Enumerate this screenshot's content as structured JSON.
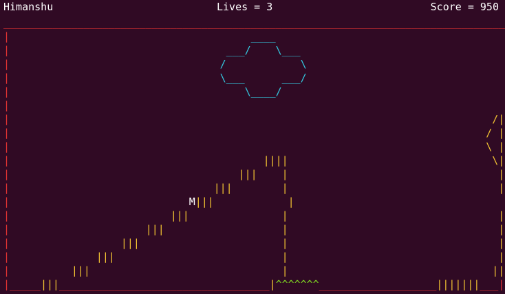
{
  "hud": {
    "player_name": "Himanshu",
    "lives": "Lives = 3",
    "score": "Score = 950"
  },
  "colors": {
    "background": "#300a24",
    "wall": "#e03333",
    "stair": "#f1c232",
    "cloud": "#33c7de",
    "spike": "#7ed321",
    "text": "#ffffff"
  },
  "board": {
    "rows": [
      [
        {
          "c": "wall",
          "t": "__________________________________________________________________________________________"
        }
      ],
      [
        {
          "c": "wall",
          "t": "|"
        },
        {
          "c": "cloud",
          "t": "                                       ____"
        },
        {
          "c": "wall",
          "t": "                                                   |"
        }
      ],
      [
        {
          "c": "wall",
          "t": "|"
        },
        {
          "c": "cloud",
          "t": "                                   ___/    \\___"
        },
        {
          "c": "wall",
          "t": "                                               |"
        }
      ],
      [
        {
          "c": "wall",
          "t": "|"
        },
        {
          "c": "cloud",
          "t": "                                  /            \\"
        },
        {
          "c": "wall",
          "t": "                                              |"
        }
      ],
      [
        {
          "c": "wall",
          "t": "|"
        },
        {
          "c": "cloud",
          "t": "                                  \\___      ___/"
        },
        {
          "c": "wall",
          "t": "                                              |"
        }
      ],
      [
        {
          "c": "wall",
          "t": "|"
        },
        {
          "c": "cloud",
          "t": "                                      \\____/"
        },
        {
          "c": "wall",
          "t": "                                                  |"
        }
      ],
      [
        {
          "c": "wall",
          "t": "|"
        },
        {
          "c": "wall",
          "t": "                                                                                          |"
        }
      ],
      [
        {
          "c": "wall",
          "t": "|"
        },
        {
          "c": "stair",
          "t": "                                                                              /|"
        },
        {
          "c": "wall",
          "t": "           |"
        }
      ],
      [
        {
          "c": "wall",
          "t": "|"
        },
        {
          "c": "stair",
          "t": "                                                                             / |"
        },
        {
          "c": "wall",
          "t": "           |"
        }
      ],
      [
        {
          "c": "wall",
          "t": "|"
        },
        {
          "c": "stair",
          "t": "                                                                             \\ |"
        },
        {
          "c": "wall",
          "t": "           |"
        }
      ],
      [
        {
          "c": "wall",
          "t": "|"
        },
        {
          "c": "stair",
          "t": "                                         ||||                                 \\|"
        },
        {
          "c": "wall",
          "t": "           |"
        }
      ],
      [
        {
          "c": "wall",
          "t": "|"
        },
        {
          "c": "stair",
          "t": "                                     |||    |                                  |"
        },
        {
          "c": "wall",
          "t": "           |"
        }
      ],
      [
        {
          "c": "wall",
          "t": "|"
        },
        {
          "c": "stair",
          "t": "                                 |||        |                                  |"
        },
        {
          "c": "wall",
          "t": "           |"
        }
      ],
      [
        {
          "c": "wall",
          "t": "|"
        },
        {
          "c": "player",
          "t": "                             M"
        },
        {
          "c": "stair",
          "t": "|||            |                                  |"
        },
        {
          "c": "wall",
          "t": "           |"
        }
      ],
      [
        {
          "c": "wall",
          "t": "|"
        },
        {
          "c": "stair",
          "t": "                          |||               |                                  |"
        },
        {
          "c": "wall",
          "t": "           |"
        }
      ],
      [
        {
          "c": "wall",
          "t": "|"
        },
        {
          "c": "stair",
          "t": "                      |||                   |                                  |"
        },
        {
          "c": "wall",
          "t": "           |"
        }
      ],
      [
        {
          "c": "wall",
          "t": "|"
        },
        {
          "c": "stair",
          "t": "                  |||                       |                                  |"
        },
        {
          "c": "wall",
          "t": "           |"
        }
      ],
      [
        {
          "c": "wall",
          "t": "|"
        },
        {
          "c": "stair",
          "t": "              |||                           |                                  |"
        },
        {
          "c": "wall",
          "t": "           |"
        }
      ],
      [
        {
          "c": "wall",
          "t": "|"
        },
        {
          "c": "stair",
          "t": "          |||                               |                                 |||"
        },
        {
          "c": "wall",
          "t": "          |"
        }
      ],
      [
        {
          "c": "wall",
          "t": "|_____"
        },
        {
          "c": "stair",
          "t": "|||"
        },
        {
          "c": "wall",
          "t": "__________________________________"
        },
        {
          "c": "stair",
          "t": "|"
        },
        {
          "c": "spike",
          "t": "^^^^^^^"
        },
        {
          "c": "wall",
          "t": "___________________"
        },
        {
          "c": "stair",
          "t": "|||||||"
        },
        {
          "c": "wall",
          "t": "___|"
        }
      ]
    ]
  }
}
